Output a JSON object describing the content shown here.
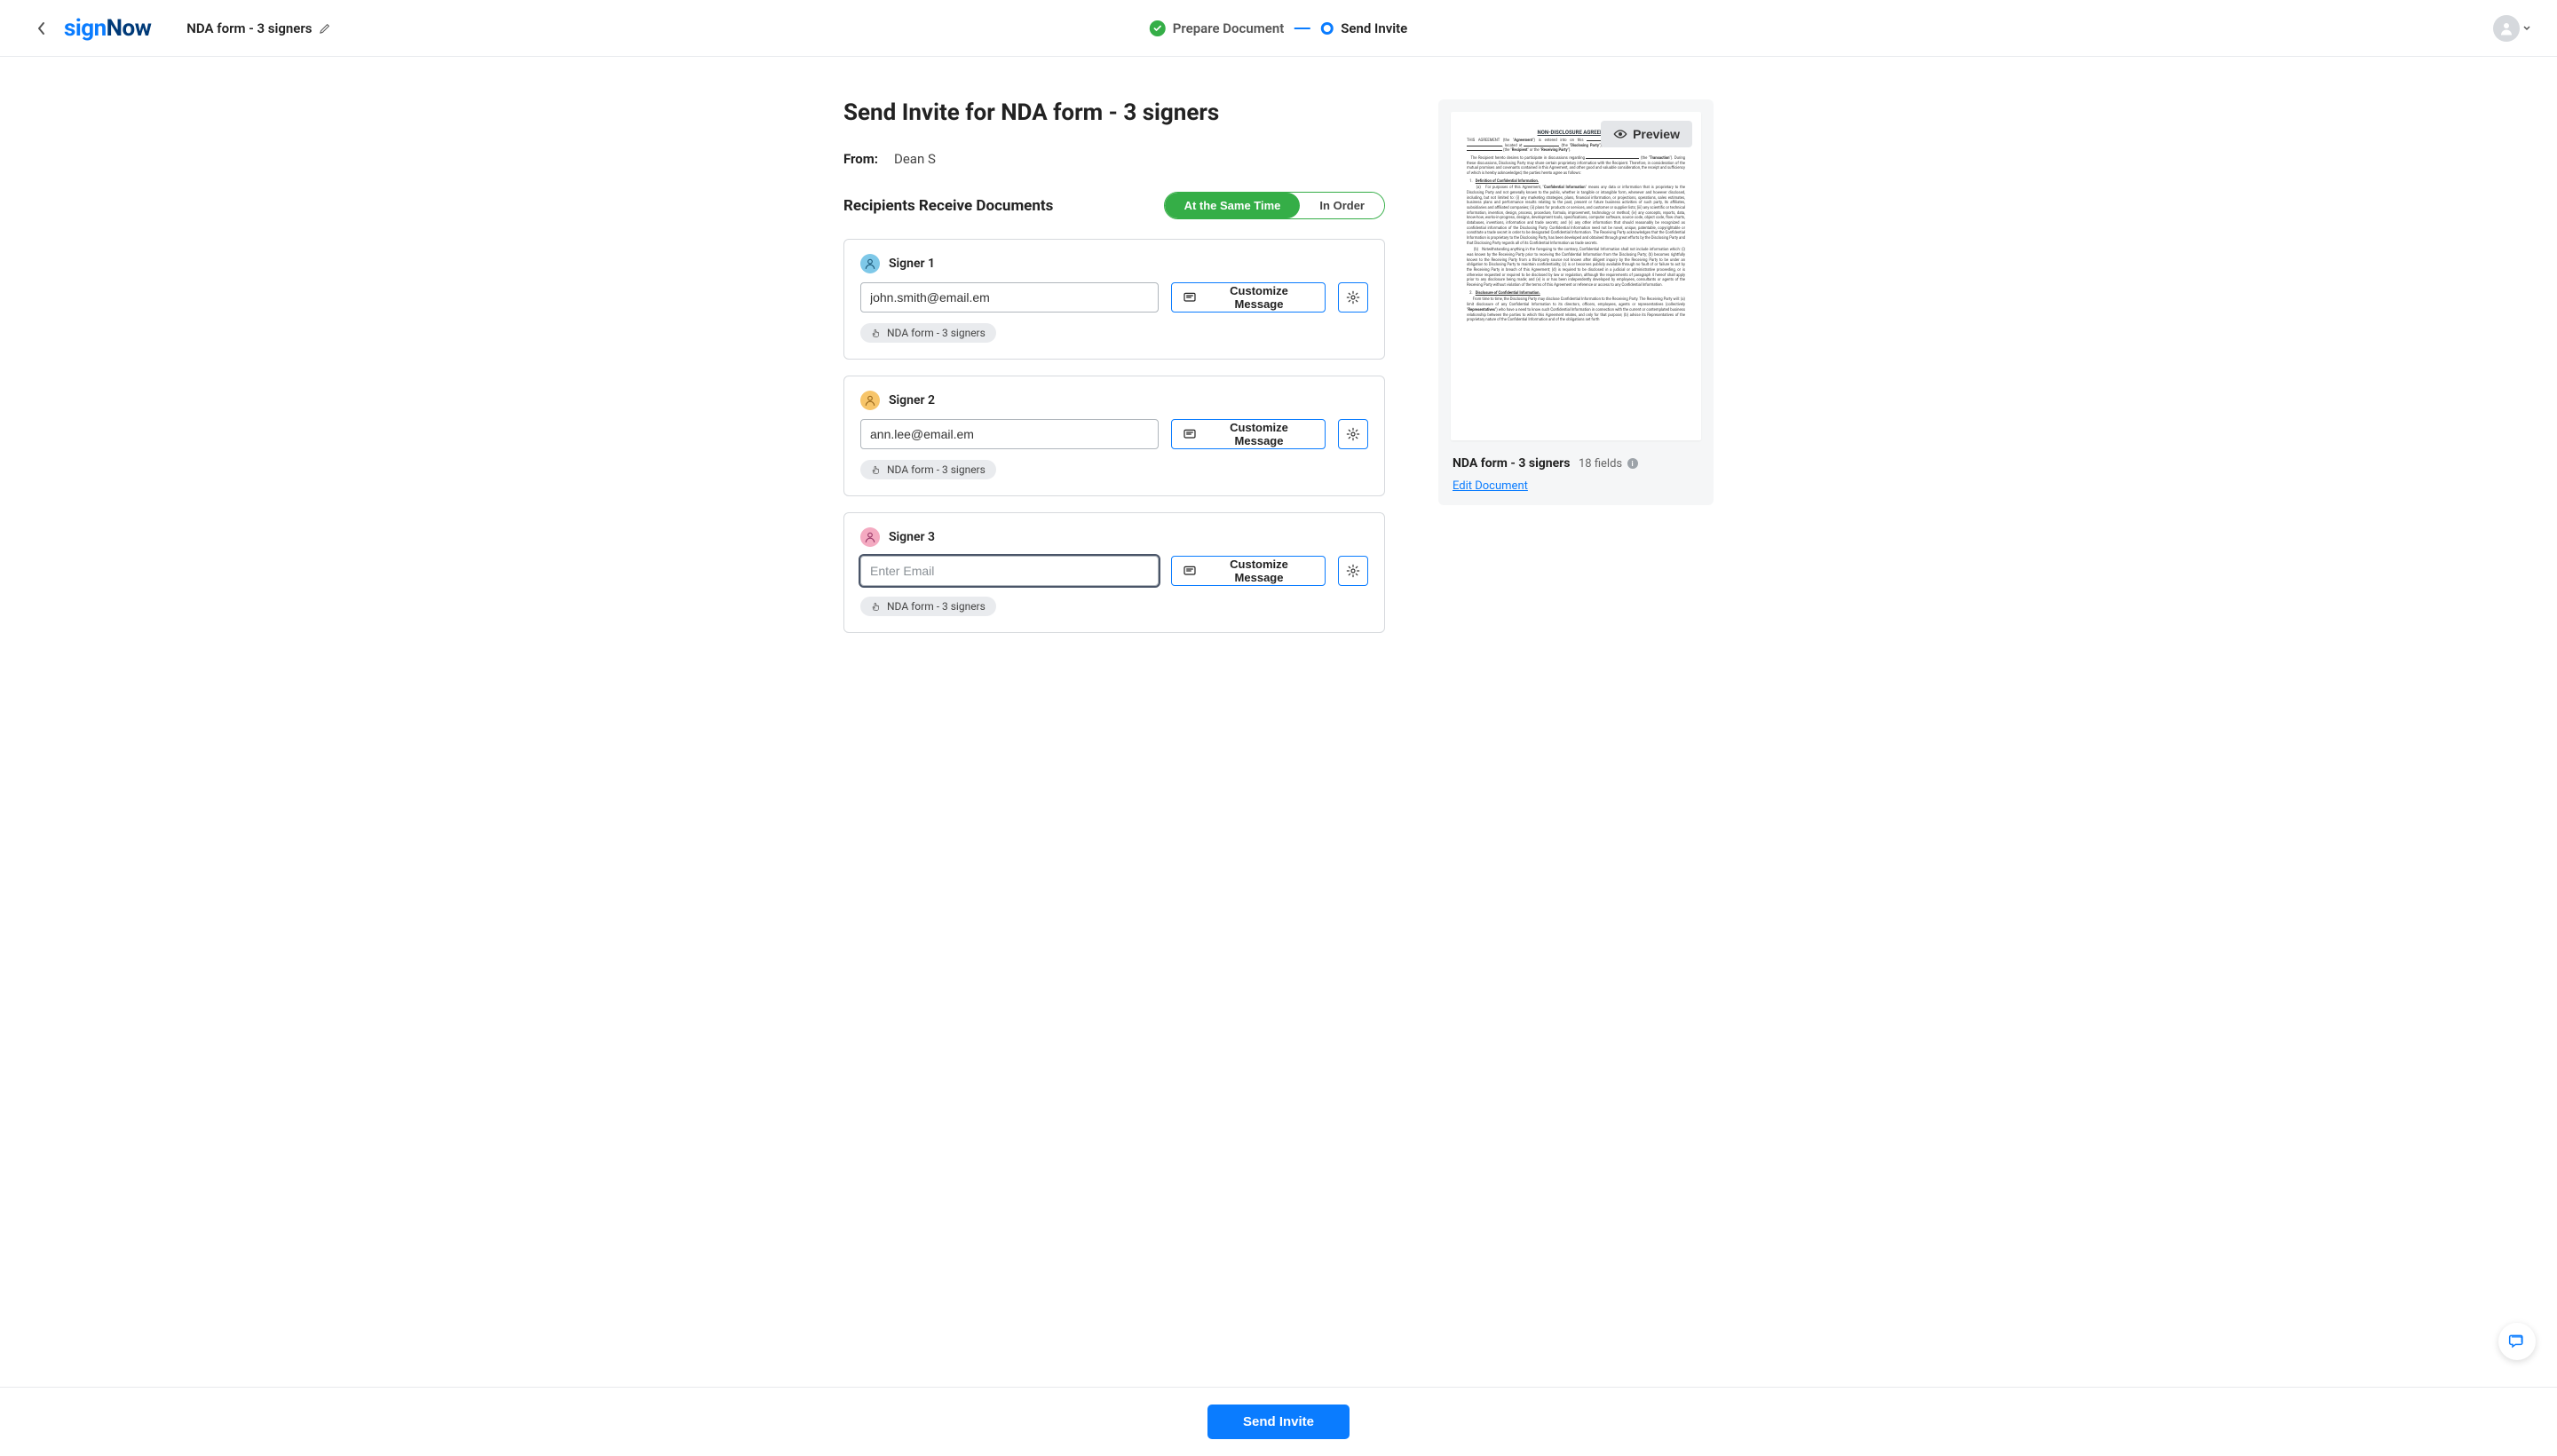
{
  "header": {
    "logo_sign": "sign",
    "logo_now": "Now",
    "doc_title": "NDA form - 3 signers"
  },
  "steps": {
    "prepare": "Prepare Document",
    "send": "Send Invite"
  },
  "page": {
    "title": "Send Invite for NDA form - 3 signers",
    "from_label": "From:",
    "from_value": "Dean S",
    "recipients_label": "Recipients Receive Documents",
    "toggle_same": "At the Same Time",
    "toggle_order": "In Order"
  },
  "signers": [
    {
      "label": "Signer 1",
      "email": "john.smith@email.em",
      "placeholder": "Enter Email",
      "doc_chip": "NDA form - 3 signers",
      "focused": false,
      "avatar_class": "sa-blue"
    },
    {
      "label": "Signer 2",
      "email": "ann.lee@email.em",
      "placeholder": "Enter Email",
      "doc_chip": "NDA form - 3 signers",
      "focused": false,
      "avatar_class": "sa-orange"
    },
    {
      "label": "Signer 3",
      "email": "",
      "placeholder": "Enter Email",
      "doc_chip": "NDA form - 3 signers",
      "focused": true,
      "avatar_class": "sa-pink"
    }
  ],
  "customize_label": "Customize Message",
  "preview": {
    "button": "Preview",
    "doc_name": "NDA form - 3 signers",
    "fields": "18 fields",
    "edit_link": "Edit Document",
    "heading": "NON-DISCLOSURE AGREEMENT"
  },
  "footer": {
    "send": "Send Invite"
  }
}
